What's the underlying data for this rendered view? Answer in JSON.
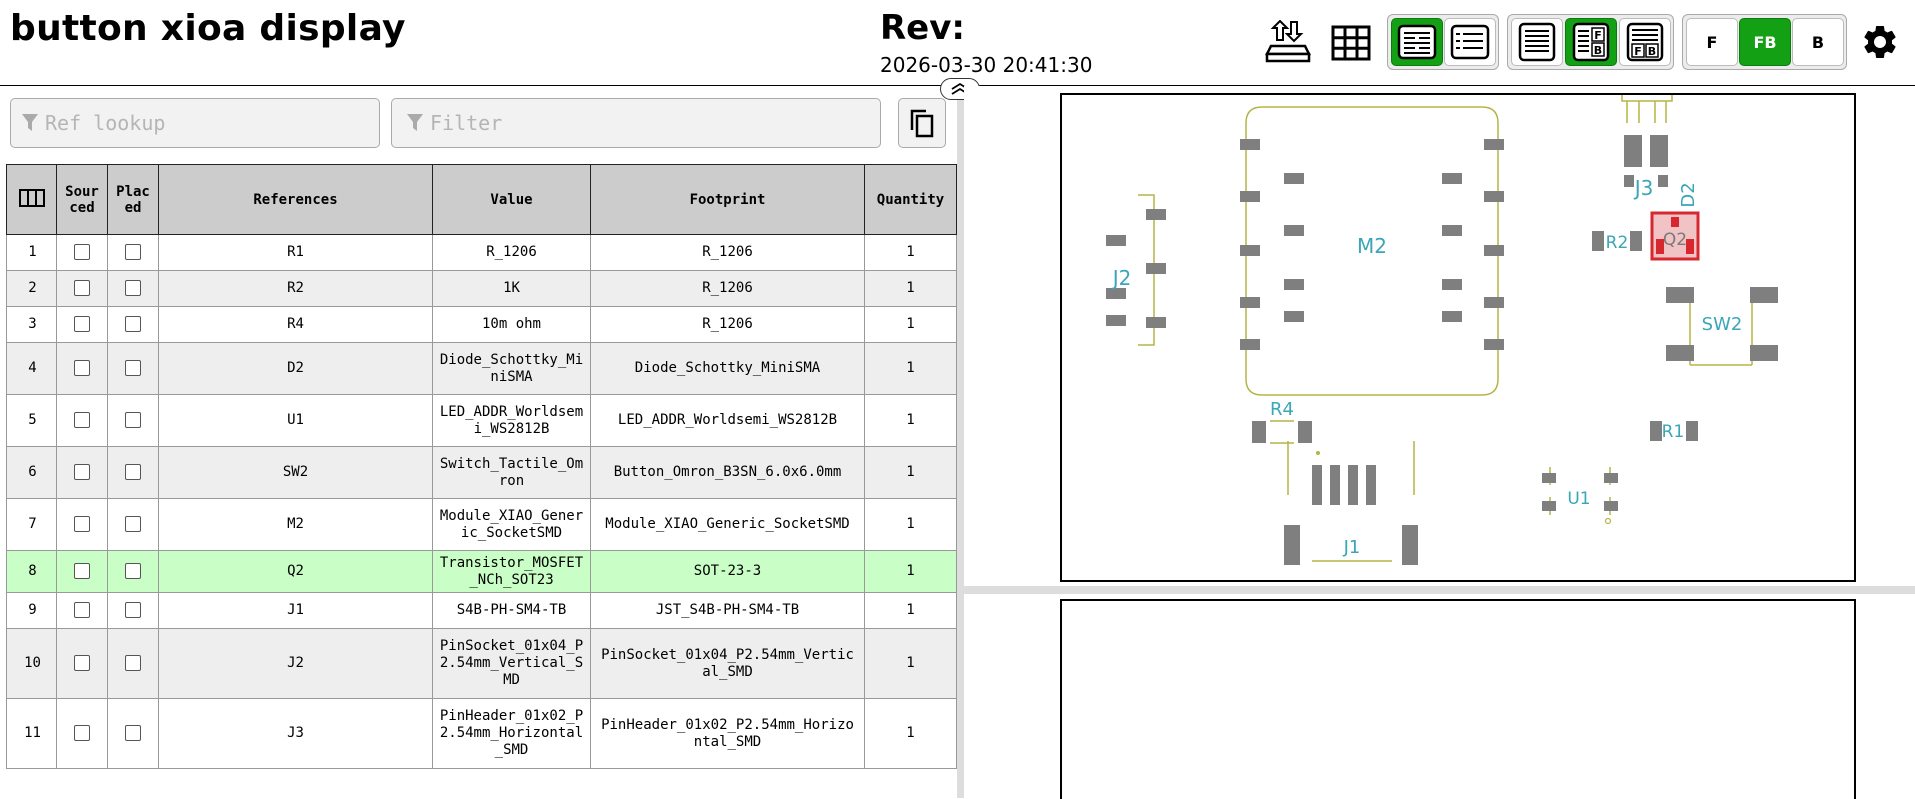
{
  "header": {
    "title": "button xioa display",
    "rev_label": "Rev:",
    "timestamp": "2026-03-30 20:41:30",
    "layer_buttons": [
      "F",
      "FB",
      "B"
    ],
    "active_layer": "FB",
    "accent_color": "#14a014"
  },
  "toolbar_icons": [
    "export-icon",
    "grid-icon",
    "bom-left-layout-icon",
    "bom-top-layout-icon",
    "bom-only-icon",
    "bom-fb-split-icon",
    "bom-fb-stacked-icon",
    "settings-gear-icon"
  ],
  "search": {
    "ref_placeholder": "Ref lookup",
    "filter_placeholder": "Filter"
  },
  "bom": {
    "columns": [
      "",
      "Sour ced",
      "Plac ed",
      "References",
      "Value",
      "Footprint",
      "Quantity"
    ],
    "highlighted_row": 8,
    "highlight_color": "#c9ffc6",
    "rows": [
      {
        "n": "1",
        "ref": "R1",
        "value": "R_1206",
        "footprint": "R_1206",
        "qty": "1"
      },
      {
        "n": "2",
        "ref": "R2",
        "value": "1K",
        "footprint": "R_1206",
        "qty": "1"
      },
      {
        "n": "3",
        "ref": "R4",
        "value": "10m ohm",
        "footprint": "R_1206",
        "qty": "1"
      },
      {
        "n": "4",
        "ref": "D2",
        "value": "Diode_Schottky_MiniSMA",
        "footprint": "Diode_Schottky_MiniSMA",
        "qty": "1"
      },
      {
        "n": "5",
        "ref": "U1",
        "value": "LED_ADDR_Worldsemi_WS2812B",
        "footprint": "LED_ADDR_Worldsemi_WS2812B",
        "qty": "1"
      },
      {
        "n": "6",
        "ref": "SW2",
        "value": "Switch_Tactile_Omron",
        "footprint": "Button_Omron_B3SN_6.0x6.0mm",
        "qty": "1"
      },
      {
        "n": "7",
        "ref": "M2",
        "value": "Module_XIAO_Generic_SocketSMD",
        "footprint": "Module_XIAO_Generic_SocketSMD",
        "qty": "1"
      },
      {
        "n": "8",
        "ref": "Q2",
        "value": "Transistor_MOSFET_NCh_SOT23",
        "footprint": "SOT-23-3",
        "qty": "1"
      },
      {
        "n": "9",
        "ref": "J1",
        "value": "S4B-PH-SM4-TB",
        "footprint": "JST_S4B-PH-SM4-TB",
        "qty": "1"
      },
      {
        "n": "10",
        "ref": "J2",
        "value": "PinSocket_01x04_P2.54mm_Vertical_SMD",
        "footprint": "PinSocket_01x04_P2.54mm_Vertical_SMD",
        "qty": "1"
      },
      {
        "n": "11",
        "ref": "J3",
        "value": "PinHeader_01x02_P2.54mm_Horizontal_SMD",
        "footprint": "PinHeader_01x02_P2.54mm_Horizontal_SMD",
        "qty": "1"
      }
    ]
  },
  "pcb": {
    "labels": [
      "M2",
      "J2",
      "J3",
      "D2",
      "R2",
      "Q2",
      "SW2",
      "R4",
      "R1",
      "U1",
      "J1"
    ],
    "label_color": "#3aa6b6",
    "pad_color": "#7f7f7f",
    "silk_color": "#b5b547",
    "highlight_color": "#d8282f"
  }
}
